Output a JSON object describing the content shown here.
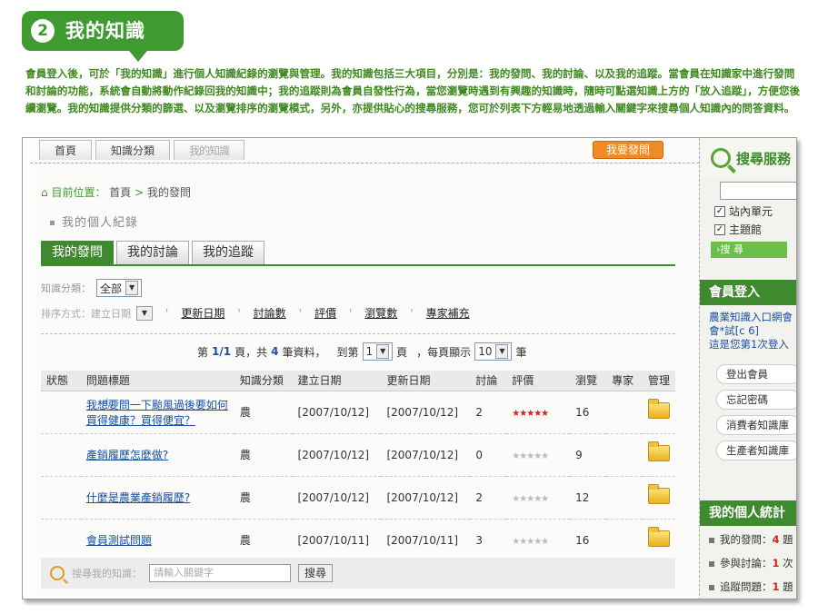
{
  "section": {
    "number": "2",
    "title": "我的知識"
  },
  "intro": "會員登入後，可於「我的知識」進行個人知識紀錄的瀏覽與管理。我的知識包括三大項目，分別是：我的發問、我的討論、以及我的追蹤。當會員在知識家中進行發問和討論的功能，系統會自動將動作紀錄回我的知識中；我的追蹤則為會員自發性行為，當您瀏覽時遇到有興趣的知識時，隨時可點選知識上方的「放入追蹤」，方便您後續瀏覽。我的知識提供分類的篩選、以及瀏覽排序的瀏覽模式，另外，亦提供貼心的搜尋服務，您可於列表下方輕易地透過輸入關鍵字來搜尋個人知識內的問答資料。",
  "topnav": {
    "tabs": [
      "首頁",
      "知識分類",
      "我的知識"
    ],
    "ask_button": "我要發問"
  },
  "breadcrumb": {
    "label": "目前位置：",
    "home": "首頁",
    "separator": ">",
    "current": "我的發問"
  },
  "section_title": "我的個人紀錄",
  "subtabs": [
    "我的發問",
    "我的討論",
    "我的追蹤"
  ],
  "filter": {
    "label": "知識分類：",
    "value": "全部"
  },
  "sort": {
    "label": "排序方式：建立日期",
    "options": [
      "更新日期",
      "討論數",
      "評價",
      "瀏覽數",
      "專家補充"
    ]
  },
  "pager": {
    "prefix": "第",
    "page": "1/1",
    "mid1": "頁，共",
    "total": "4",
    "mid2": "筆資料，",
    "goto_label": "到第",
    "goto_value": "1",
    "goto_suffix": "頁",
    "per_label": "，每頁顯示",
    "per_value": "10",
    "per_suffix": "筆"
  },
  "table": {
    "headers": [
      "狀態",
      "問題標題",
      "知識分類",
      "建立日期",
      "更新日期",
      "討論",
      "評價",
      "瀏覽",
      "專家",
      "管理"
    ],
    "rows": [
      {
        "status": "",
        "title": "我想要問一下颱風過後要如何買得健康？買得便宜？",
        "category": "農",
        "created": "[2007/10/12]",
        "updated": "[2007/10/12]",
        "discuss": "2",
        "rating": 5,
        "views": "16",
        "expert": ""
      },
      {
        "status": "",
        "title": "產銷履歷怎麼做?",
        "category": "農",
        "created": "[2007/10/12]",
        "updated": "[2007/10/12]",
        "discuss": "0",
        "rating": 0,
        "views": "9",
        "expert": ""
      },
      {
        "status": "",
        "title": "什麼是農業產銷履歷?",
        "category": "農",
        "created": "[2007/10/12]",
        "updated": "[2007/10/12]",
        "discuss": "2",
        "rating": 0,
        "views": "12",
        "expert": ""
      },
      {
        "status": "",
        "title": "會員測試問題",
        "category": "農",
        "created": "[2007/10/11]",
        "updated": "[2007/10/11]",
        "discuss": "3",
        "rating": 0,
        "views": "16",
        "expert": ""
      }
    ]
  },
  "search": {
    "label": "搜尋我的知識：",
    "placeholder": "請輸入關鍵字",
    "button": "搜尋"
  },
  "sidebar": {
    "search_title": "搜尋服務",
    "checks": [
      "站內單元",
      "主題館"
    ],
    "search_button": "›搜 尋",
    "member_title": "會員登入",
    "member_text1": "農業知識入口網會",
    "member_text2": "會*試[c        6]",
    "member_text3": "這是您第1次登入",
    "links": [
      "登出會員",
      "忘記密碼",
      "消費者知識庫",
      "生產者知識庫"
    ],
    "stats_title": "我的個人統計",
    "stats": [
      {
        "label": "我的發問：",
        "value": "4",
        "unit": "題"
      },
      {
        "label": "參與討論：",
        "value": "1",
        "unit": "次"
      },
      {
        "label": "追蹤問題：",
        "value": "1",
        "unit": "題"
      }
    ]
  },
  "colors": {
    "green": "#3f8a2f",
    "orange": "#f08a24",
    "link": "#1a4fa0",
    "star_on": "#d4241c"
  }
}
